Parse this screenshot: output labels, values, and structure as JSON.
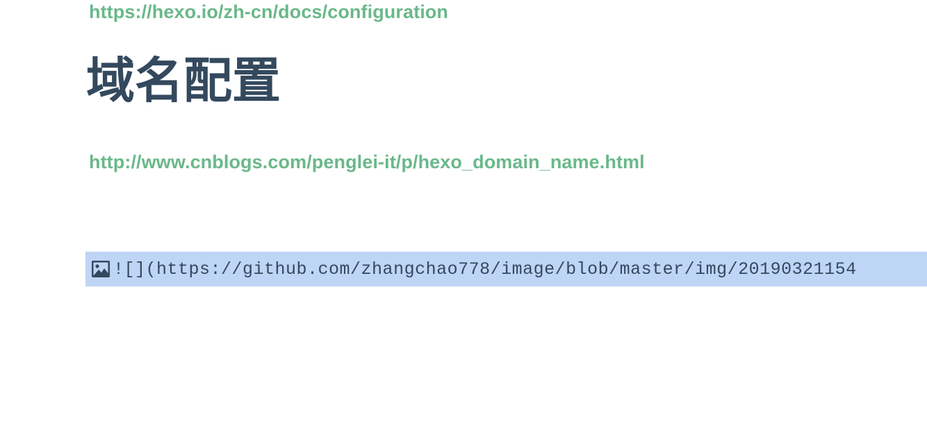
{
  "links": {
    "config_url": "https://hexo.io/zh-cn/docs/configuration",
    "domain_url": "http://www.cnblogs.com/penglei-it/p/hexo_domain_name.html"
  },
  "heading": {
    "title": "域名配置"
  },
  "image_markdown": {
    "icon": "image-icon",
    "text": "![](https://github.com/zhangchao778/image/blob/master/img/20190321154"
  },
  "colors": {
    "link": "#6ab88a",
    "heading": "#34495e",
    "selection": "#bed5f6"
  }
}
